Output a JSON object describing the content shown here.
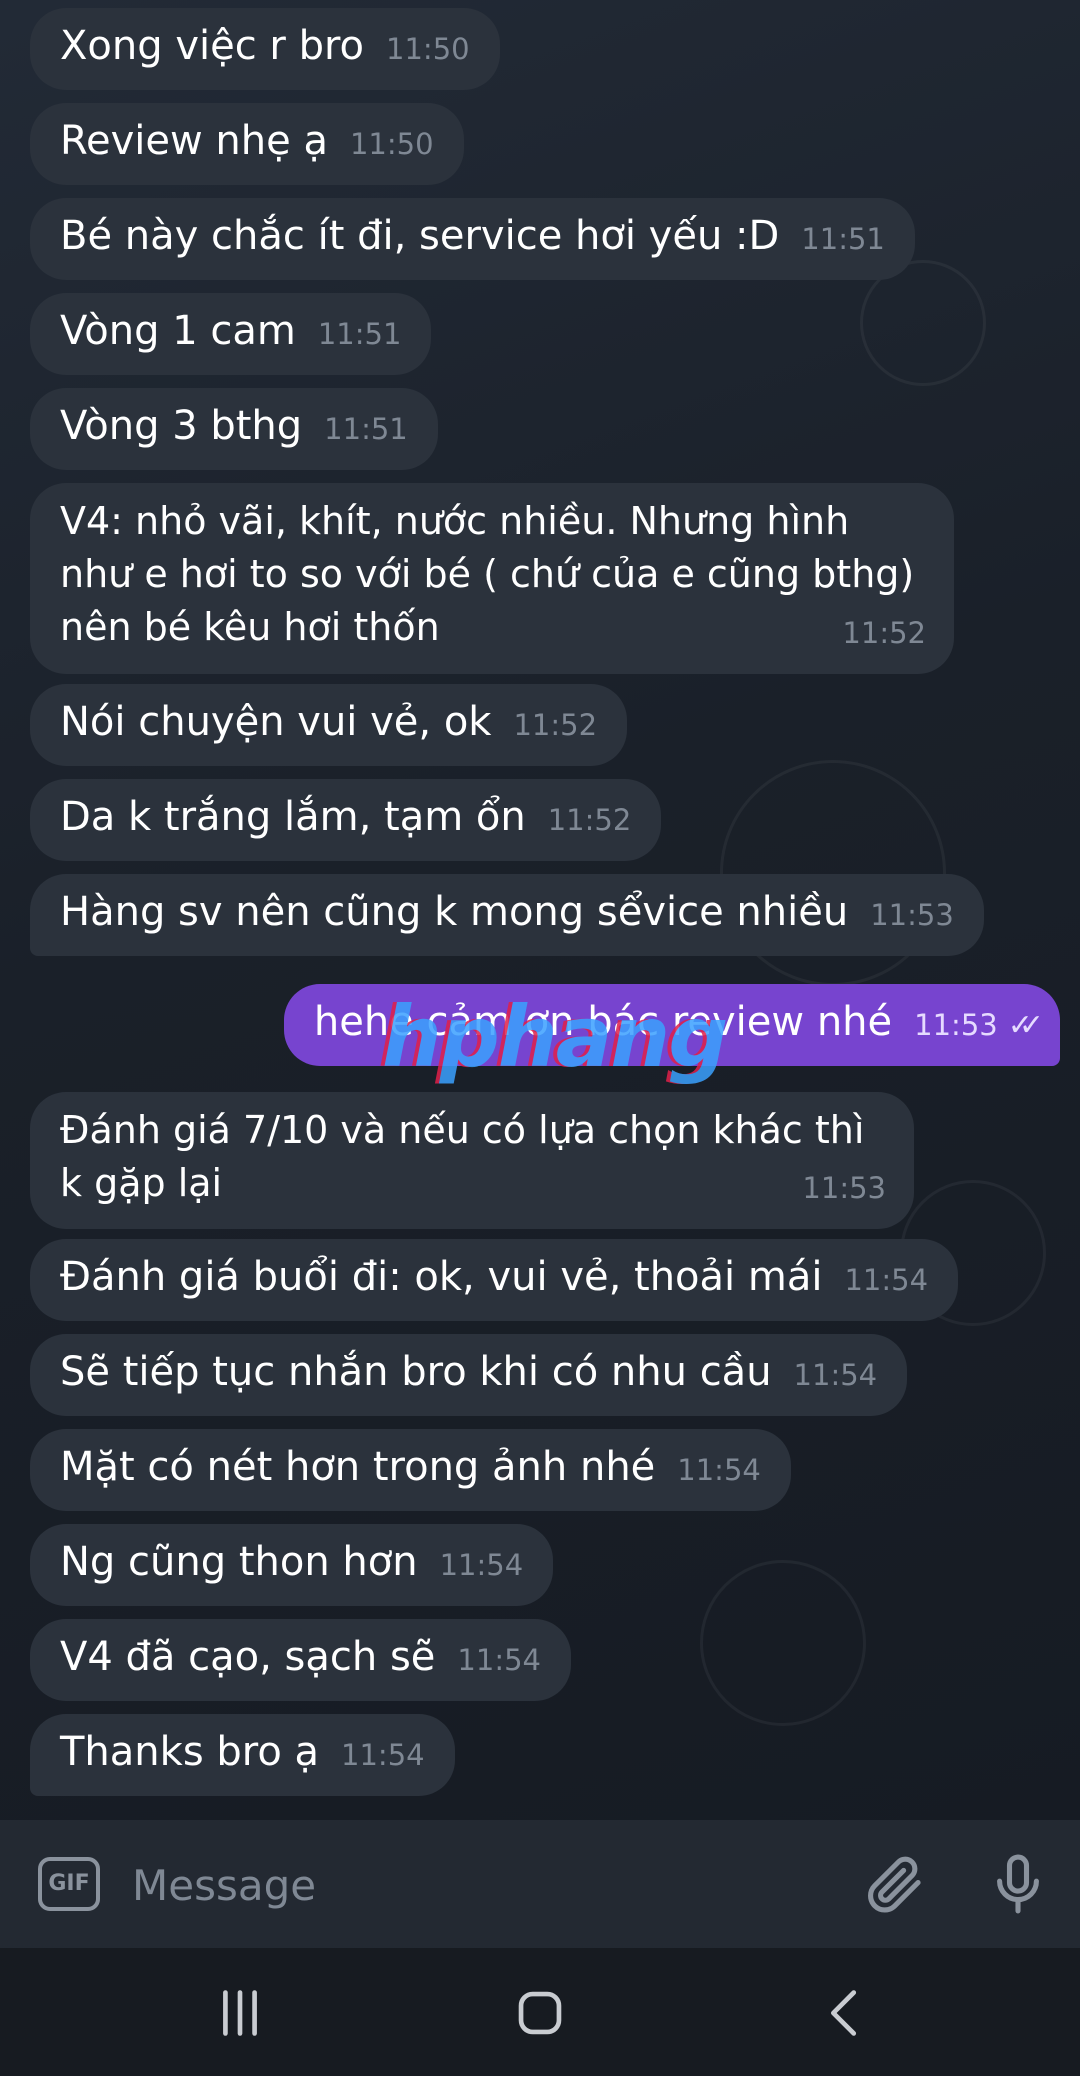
{
  "messages": [
    {
      "text": "Xong việc r bro",
      "time": "11:50",
      "direction": "in"
    },
    {
      "text": "Review nhẹ ạ",
      "time": "11:50",
      "direction": "in"
    },
    {
      "text": "Bé này chắc ít đi, service hơi yếu :D",
      "time": "11:51",
      "direction": "in"
    },
    {
      "text": "Vòng 1 cam",
      "time": "11:51",
      "direction": "in"
    },
    {
      "text": "Vòng 3 bthg",
      "time": "11:51",
      "direction": "in"
    },
    {
      "text": "V4: nhỏ vãi, khít, nước nhiều. Nhưng hình như e hơi to so với bé ( chứ của e cũng bthg) nên bé kêu hơi thốn",
      "time": "11:52",
      "direction": "in"
    },
    {
      "text": "Nói chuyện vui vẻ, ok",
      "time": "11:52",
      "direction": "in"
    },
    {
      "text": "Da k trắng lắm, tạm ổn",
      "time": "11:52",
      "direction": "in"
    },
    {
      "text": "Hàng sv nên cũng k mong sểvice nhiều",
      "time": "11:53",
      "direction": "in"
    },
    {
      "text": "hehe cảm ơn bác review nhé",
      "time": "11:53",
      "direction": "out"
    },
    {
      "text": "Đánh giá 7/10 và nếu có lựa chọn khác thì k gặp lại",
      "time": "11:53",
      "direction": "in"
    },
    {
      "text": "Đánh giá buổi đi: ok, vui vẻ, thoải mái",
      "time": "11:54",
      "direction": "in"
    },
    {
      "text": "Sẽ tiếp tục nhắn bro khi có nhu cầu",
      "time": "11:54",
      "direction": "in"
    },
    {
      "text": "Mặt có nét hơn trong ảnh nhé",
      "time": "11:54",
      "direction": "in"
    },
    {
      "text": "Ng cũng thon hơn",
      "time": "11:54",
      "direction": "in"
    },
    {
      "text": "V4 đã cạo, sạch sẽ",
      "time": "11:54",
      "direction": "in"
    },
    {
      "text": "Thanks bro ạ",
      "time": "11:54",
      "direction": "in"
    }
  ],
  "watermark": "hphang",
  "input": {
    "placeholder": "Message",
    "gif_label": "GIF"
  },
  "icons": {
    "gif": "gif-icon",
    "attach": "paperclip-icon",
    "mic": "microphone-icon",
    "nav_recent": "recent-apps-icon",
    "nav_home": "home-icon",
    "nav_back": "back-icon"
  },
  "colors": {
    "incoming_bubble": "#2b323c",
    "outgoing_bubble": "#7744cf",
    "background": "#1b2029",
    "timestamp": "#7f8894"
  }
}
